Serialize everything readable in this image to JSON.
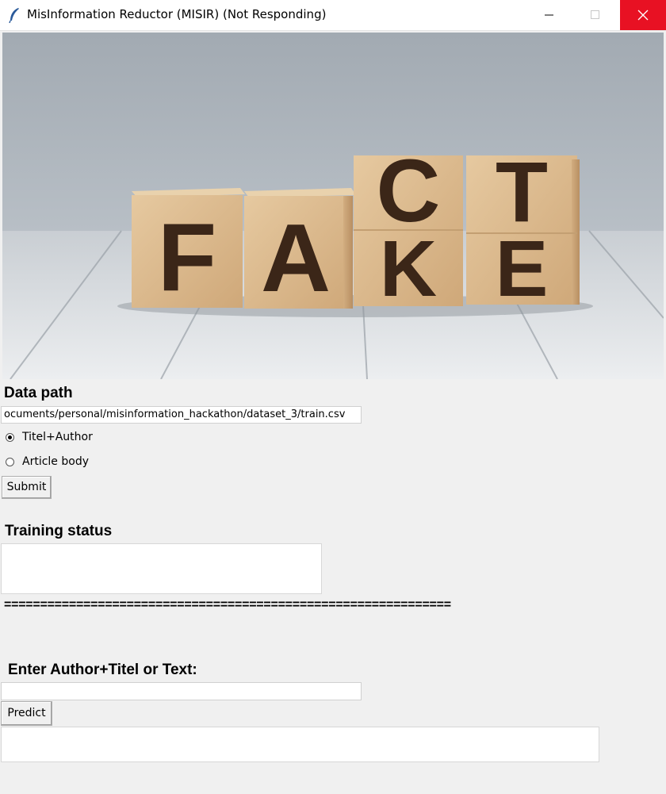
{
  "window": {
    "title": "MisInformation Reductor (MISIR) (Not Responding)",
    "icon": "feather-icon",
    "controls": [
      "minimize-icon",
      "maximize-icon",
      "close-icon"
    ],
    "close_color": "#e81123"
  },
  "hero": {
    "image": "wooden-blocks-fake-fact-photo",
    "block_letters_front": [
      "F",
      "A",
      "K",
      "E"
    ],
    "block_letters_top": [
      "C",
      "T"
    ]
  },
  "data_section": {
    "label": "Data path",
    "path_value": "ocuments/personal/misinformation_hackathon/dataset_3/train.csv",
    "options": [
      {
        "label": "Titel+Author",
        "selected": true
      },
      {
        "label": "Article body",
        "selected": false
      }
    ],
    "submit_label": "Submit"
  },
  "training": {
    "label": "Training status",
    "status_text": ""
  },
  "separator": "==============================================================",
  "predict_section": {
    "label": "Enter Author+Titel or Text:",
    "input_value": "",
    "predict_label": "Predict",
    "result_text": ""
  }
}
